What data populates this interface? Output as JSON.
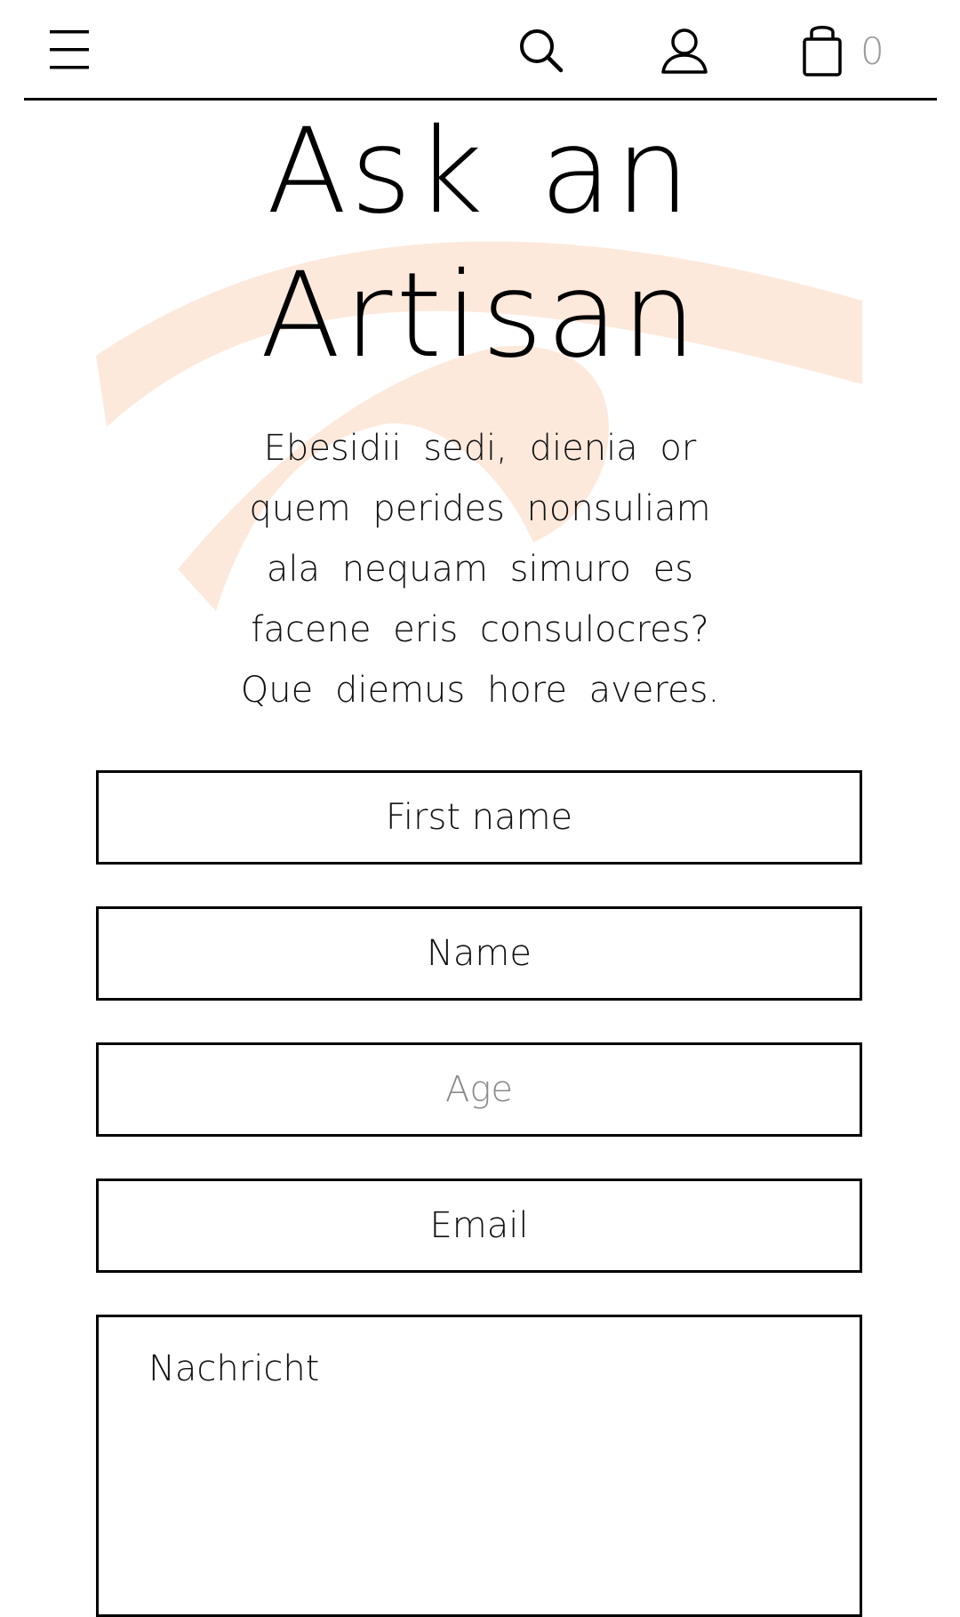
{
  "header": {
    "menu_icon": "hamburger-menu-icon",
    "search_icon": "search-icon",
    "account_icon": "user-icon",
    "cart_icon": "shopping-bag-icon",
    "cart_count": "0"
  },
  "hero": {
    "title": "Ask an Artisan",
    "intro": "Ebesidii sedi, dienia or quem perides nonsuliam ala nequam simuro es facene eris consulocres? Que diemus hore averes.",
    "accent_color": "#fde9dc"
  },
  "form": {
    "first_name_placeholder": "First name",
    "name_placeholder": "Name",
    "age_placeholder": "Age",
    "email_placeholder": "Email",
    "message_placeholder": "Nachricht"
  }
}
